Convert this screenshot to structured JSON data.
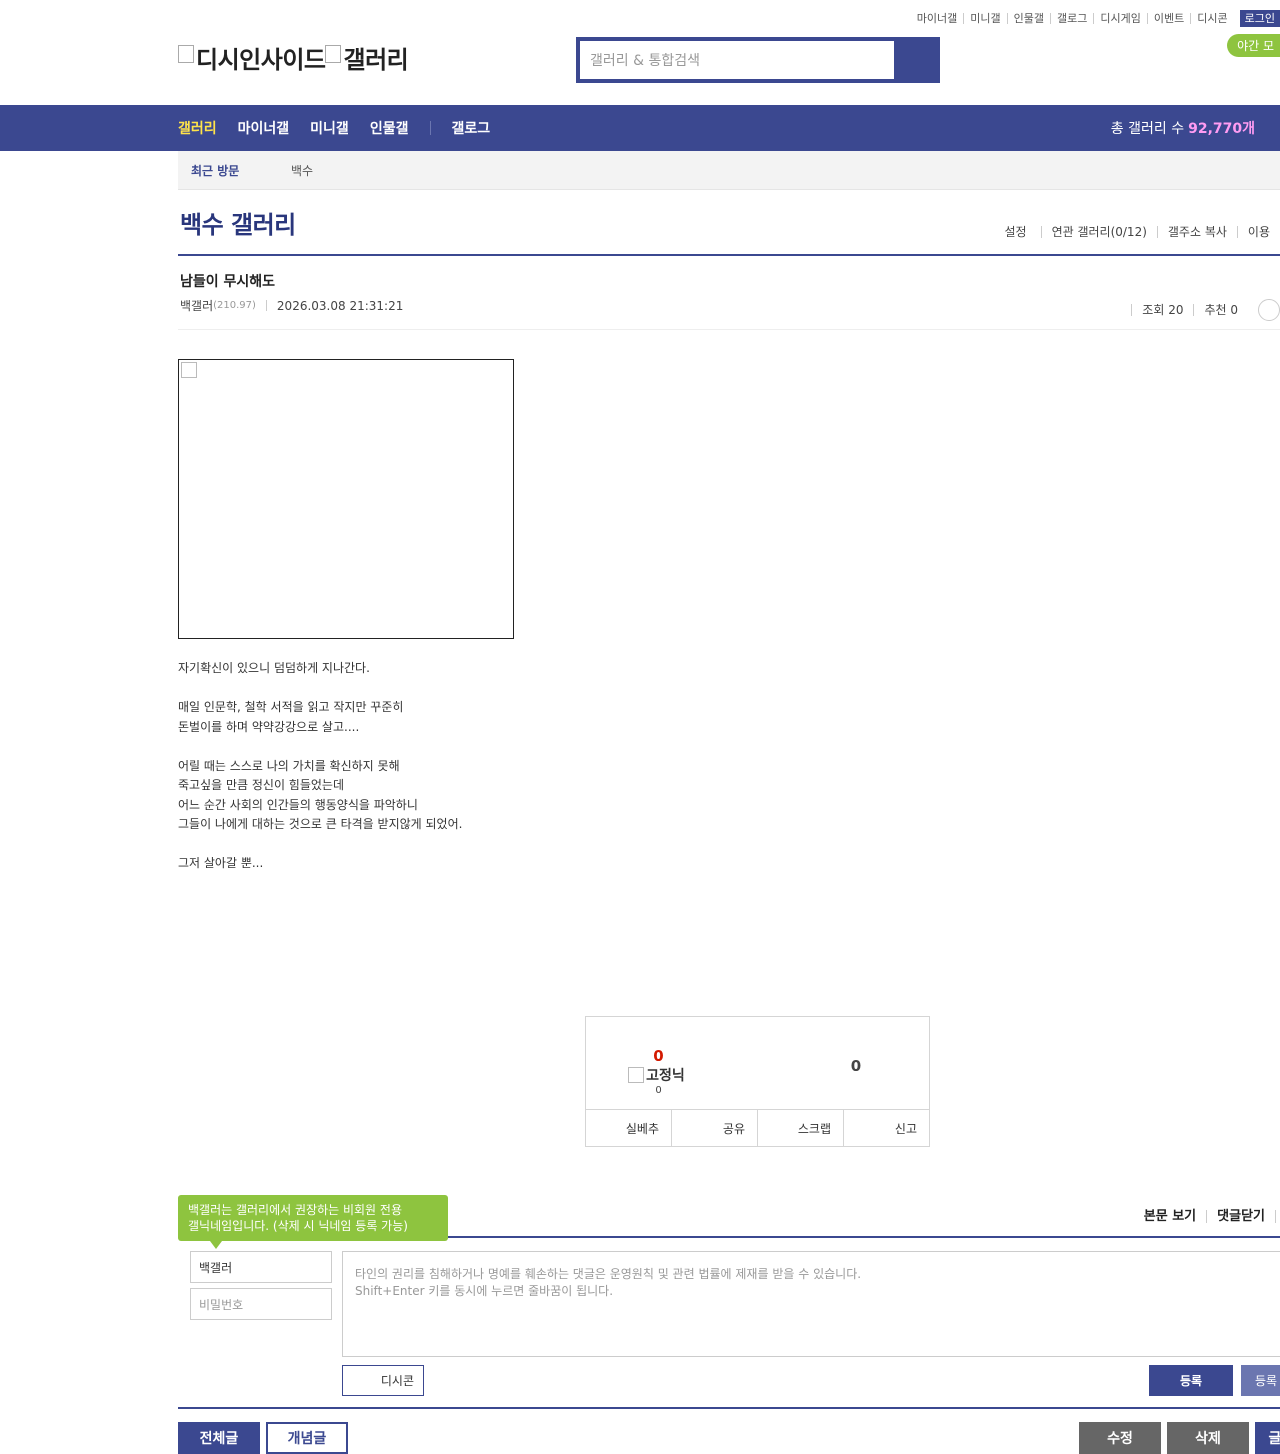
{
  "util_menu": [
    "마이너갤",
    "미니갤",
    "인물갤",
    "갤로그",
    "디시게임",
    "이벤트",
    "디시콘"
  ],
  "login_label": "로그인",
  "night_mode_label": "야간 모",
  "logo": {
    "left": "디시인사이드",
    "right": "갤러리"
  },
  "search": {
    "placeholder": "갤러리 & 통합검색"
  },
  "gnb": {
    "items": [
      "갤러리",
      "마이너갤",
      "미니갤",
      "인물갤"
    ],
    "gallog": "갤로그",
    "count_label": "총 갤러리 수",
    "count_value": "92,770개"
  },
  "recent": {
    "label": "최근 방문",
    "item": "백수"
  },
  "gallery": {
    "title": "백수 갤러리",
    "options": [
      "설정",
      "연관 갤러리(0/12)",
      "갤주소 복사",
      "이용"
    ]
  },
  "post": {
    "title": "남들이 무시해도",
    "author": "백갤러",
    "ip": "(210.97)",
    "date": "2026.03.08 21:31:21",
    "views": "조회 20",
    "recommends": "추천 0",
    "lines": [
      "자기확신이 있으니 덤덤하게 지나간다.",
      "",
      "매일 인문학, 철학 서적을 읽고 작지만 꾸준히",
      "돈벌이를 하며 약약강강으로 살고....",
      "",
      "어릴 때는 스스로 나의 가치를 확신하지 못해",
      "죽고싶을 만큼 정신이 힘들었는데",
      "어느 순간 사회의 인간들의 행동양식을 파악하니",
      "그들이 나에게 대하는 것으로 큰 타격을 받지않게 되었어.",
      "",
      "그저 살아갈 뿐..."
    ]
  },
  "recommend": {
    "up": "0",
    "fixed_label": "고정닉",
    "fixed_count": "0",
    "down": "0",
    "buttons": [
      "실베추",
      "공유",
      "스크랩",
      "신고"
    ]
  },
  "comment": {
    "tooltip_line1": "백갤러는 갤러리에서 권장하는 비회원 전용",
    "tooltip_line2": "갤닉네임입니다. (삭제 시 닉네임 등록 가능)",
    "view_options": [
      "본문 보기",
      "댓글닫기",
      ""
    ],
    "nickname": "백갤러",
    "password_placeholder": "비밀번호",
    "textarea_line1": "타인의 권리를 침해하거나 명예를 훼손하는 댓글은 운영원칙 및 관련 법률에 제재를 받을 수 있습니다.",
    "textarea_line2": "Shift+Enter 키를 동시에 누르면 줄바꿈이 됩니다.",
    "dccon_label": "디시콘",
    "submit_label": "등록",
    "submit2_label": "등록"
  },
  "bottom": {
    "all": "전체글",
    "recommended": "개념글",
    "edit": "수정",
    "delete": "삭제",
    "write": "글"
  },
  "colors": {
    "brand": "#3b4890",
    "accent_green": "#8ec43f",
    "active_menu": "#ffe34a",
    "count": "#ff9cf2",
    "recommend_up": "#d31900"
  }
}
